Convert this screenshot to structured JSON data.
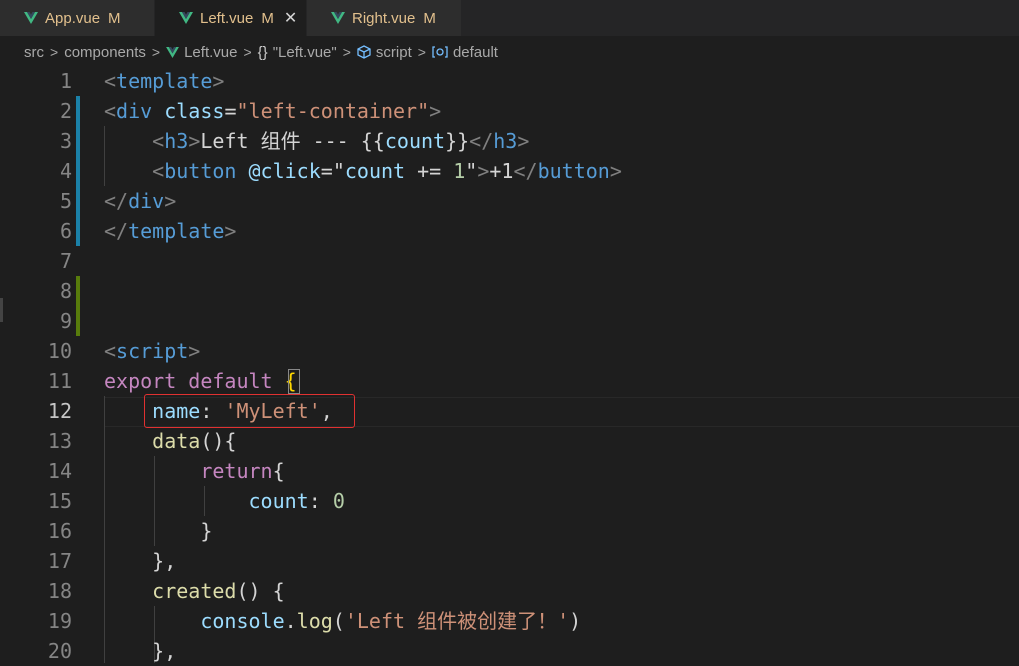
{
  "tabs": [
    {
      "label": "App.vue",
      "status": "M",
      "active": false
    },
    {
      "label": "Left.vue",
      "status": "M",
      "active": true,
      "close": "✕"
    },
    {
      "label": "Right.vue",
      "status": "M",
      "active": false
    }
  ],
  "breadcrumb": {
    "folder1": "src",
    "folder2": "components",
    "file": "Left.vue",
    "braces": "{}",
    "object": "\"Left.vue\"",
    "section": "script",
    "symbol": "default"
  },
  "colors": {
    "tag": "#569cd6",
    "attribute": "#9cdcfe",
    "string": "#ce9178",
    "keyword": "#c586c0",
    "number": "#b5cea8",
    "function": "#dcdcaa",
    "modified_gutter": "#1b81a8",
    "added_gutter": "#587c0c",
    "highlight_box": "#e03131"
  },
  "editor": {
    "current_line": 12,
    "lines": [
      {
        "n": "1"
      },
      {
        "n": "2"
      },
      {
        "n": "3"
      },
      {
        "n": "4"
      },
      {
        "n": "5"
      },
      {
        "n": "6"
      },
      {
        "n": "7"
      },
      {
        "n": "8"
      },
      {
        "n": "9"
      },
      {
        "n": "10"
      },
      {
        "n": "11"
      },
      {
        "n": "12"
      },
      {
        "n": "13"
      },
      {
        "n": "14"
      },
      {
        "n": "15"
      },
      {
        "n": "16"
      },
      {
        "n": "17"
      },
      {
        "n": "18"
      },
      {
        "n": "19"
      },
      {
        "n": "20"
      }
    ],
    "code": {
      "l1": {
        "open": "<",
        "tag": "template",
        "close": ">"
      },
      "l2": {
        "open": "<",
        "tag": "div",
        "sp": " ",
        "attr": "class",
        "eq": "=",
        "val": "\"left-container\"",
        "close": ">"
      },
      "l3": {
        "indent": "    ",
        "open": "<",
        "tag": "h3",
        "close": ">",
        "text1": "Left 组件 --- {{",
        "expr": "count",
        "text2": "}}",
        "copen": "</",
        "ctag": "h3",
        "cclose": ">"
      },
      "l4": {
        "indent": "    ",
        "open": "<",
        "tag": "button",
        "sp": " ",
        "attr": "@click",
        "eq": "=",
        "q1": "\"",
        "expr": "count",
        "op": " += ",
        "num": "1",
        "q2": "\"",
        "close": ">",
        "text": "+1",
        "copen": "</",
        "ctag": "button",
        "cclose": ">"
      },
      "l5": {
        "open": "</",
        "tag": "div",
        "close": ">"
      },
      "l6": {
        "open": "</",
        "tag": "template",
        "close": ">"
      },
      "l10": {
        "open": "<",
        "tag": "script",
        "close": ">"
      },
      "l11": {
        "kw1": "export",
        "sp": " ",
        "kw2": "default",
        "sp2": " ",
        "brace": "{"
      },
      "l12": {
        "indent": "    ",
        "key": "name",
        "colon": ": ",
        "str": "'MyLeft'",
        "comma": ","
      },
      "l13": {
        "indent": "    ",
        "fn": "data",
        "rest": "(){"
      },
      "l14": {
        "indent": "        ",
        "kw": "return",
        "brace": "{"
      },
      "l15": {
        "indent": "            ",
        "key": "count",
        "colon": ": ",
        "num": "0"
      },
      "l16": {
        "indent": "        ",
        "brace": "}"
      },
      "l17": {
        "indent": "    ",
        "text": "},"
      },
      "l18": {
        "indent": "    ",
        "fn": "created",
        "rest": "() {"
      },
      "l19": {
        "indent": "        ",
        "obj": "console",
        "dot": ".",
        "fn": "log",
        "p1": "(",
        "str": "'Left 组件被创建了！'",
        "p2": ")"
      },
      "l20": {
        "indent": "    ",
        "text": "},"
      }
    }
  }
}
